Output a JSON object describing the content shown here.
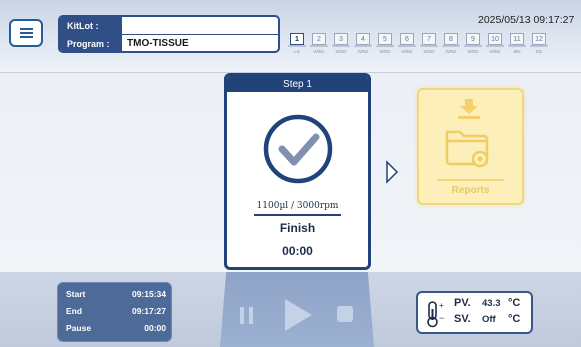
{
  "header": {
    "kitlot_label": "KitLot :",
    "kitlot_value": "",
    "program_label": "Program :",
    "program_value": "TMO-TISSUE",
    "datetime": "2025/05/13 09:17:27",
    "stations": [
      {
        "num": "1",
        "label": "LS",
        "active": true
      },
      {
        "num": "2",
        "label": "W/B1",
        "active": false
      },
      {
        "num": "3",
        "label": "W/B2",
        "active": false
      },
      {
        "num": "4",
        "label": "W/B2",
        "active": false
      },
      {
        "num": "5",
        "label": "W/B2",
        "active": false
      },
      {
        "num": "6",
        "label": "W/B2",
        "active": false
      },
      {
        "num": "7",
        "label": "W/B2",
        "active": false
      },
      {
        "num": "8",
        "label": "W/B2",
        "active": false
      },
      {
        "num": "9",
        "label": "W/B2",
        "active": false
      },
      {
        "num": "10",
        "label": "W/B2",
        "active": false
      },
      {
        "num": "11",
        "label": "MN",
        "active": false
      },
      {
        "num": "12",
        "label": "EB",
        "active": false
      }
    ]
  },
  "step": {
    "title": "Step 1",
    "speed": "1100µl / 3000rpm",
    "status": "Finish",
    "time": "00:00",
    "accent": "#22427a"
  },
  "reports": {
    "label": "Reports"
  },
  "times": {
    "start_label": "Start",
    "start_value": "09:15:34",
    "end_label": "End",
    "end_value": "09:17:27",
    "pause_label": "Pause",
    "pause_value": "00:00"
  },
  "temperature": {
    "pv_label": "PV.",
    "pv_value": "43.3",
    "pv_unit": "°C",
    "sv_label": "SV.",
    "sv_value": "Off",
    "sv_unit": "°C"
  }
}
